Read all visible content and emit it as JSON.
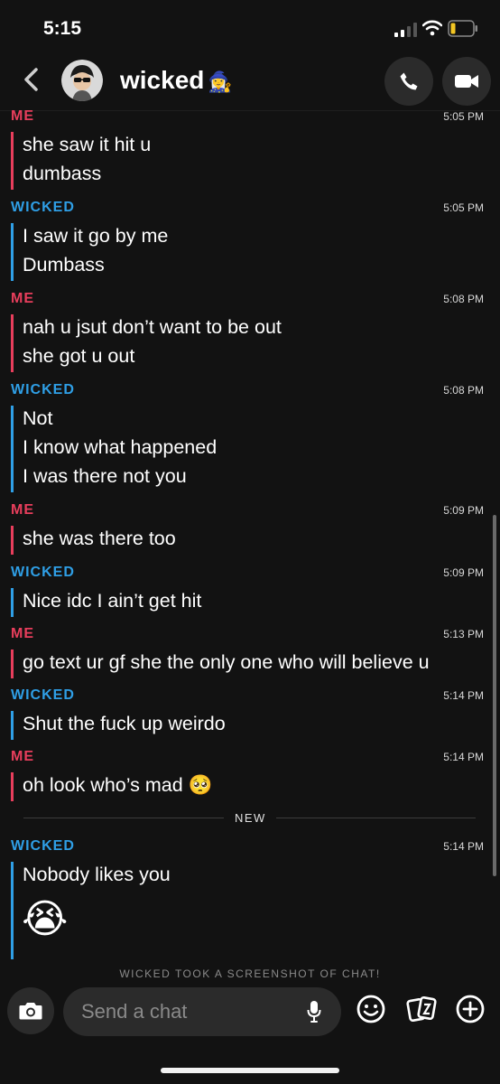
{
  "status_bar": {
    "time": "5:15"
  },
  "header": {
    "title": "wicked",
    "emoji": "🧙‍♀️"
  },
  "messages": [
    {
      "sender": "ME",
      "time": "5:05 PM",
      "lines": [
        "she saw it hit u",
        "dumbass"
      ]
    },
    {
      "sender": "WICKED",
      "time": "5:05 PM",
      "lines": [
        "I saw it go by me",
        "Dumbass"
      ]
    },
    {
      "sender": "ME",
      "time": "5:08 PM",
      "lines": [
        "nah u jsut don’t want to be out",
        "she got u out"
      ]
    },
    {
      "sender": "WICKED",
      "time": "5:08 PM",
      "lines": [
        "Not",
        "I know what happened",
        "I was there not you"
      ]
    },
    {
      "sender": "ME",
      "time": "5:09 PM",
      "lines": [
        "she was there too"
      ]
    },
    {
      "sender": "WICKED",
      "time": "5:09 PM",
      "lines": [
        "Nice idc I ain’t get hit"
      ]
    },
    {
      "sender": "ME",
      "time": "5:13 PM",
      "lines": [
        "go text ur gf she the only one who will believe u"
      ]
    },
    {
      "sender": "WICKED",
      "time": "5:14 PM",
      "lines": [
        "Shut the fuck up weirdo"
      ]
    },
    {
      "sender": "ME",
      "time": "5:14 PM",
      "lines": [
        "oh look who’s mad 🥺"
      ]
    },
    {
      "sender": "WICKED",
      "time": "5:14 PM",
      "lines": [
        "Nobody likes you"
      ],
      "emoji": "😭"
    }
  ],
  "new_divider": "NEW",
  "screenshot_notice": "WICKED TOOK A SCREENSHOT OF CHAT!",
  "input": {
    "placeholder": "Send a chat"
  },
  "colors": {
    "me": "#e83e5c",
    "them": "#2f9fe6",
    "background": "#121212"
  },
  "icons": [
    "back-chevron-icon",
    "avatar",
    "phone-icon",
    "video-camera-icon",
    "camera-icon",
    "microphone-icon",
    "smiley-icon",
    "stickers-icon",
    "plus-icon"
  ]
}
